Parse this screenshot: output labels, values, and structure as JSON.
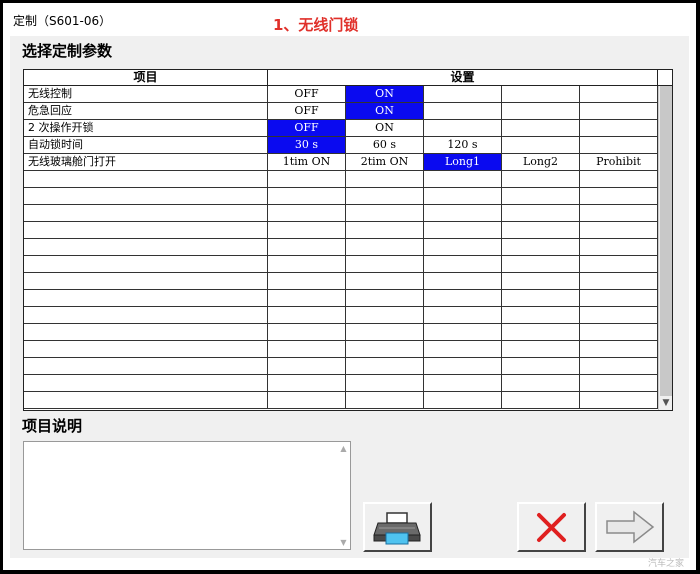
{
  "window": {
    "title": "定制（S601-06）",
    "annotation": "1、无线门锁"
  },
  "labels": {
    "select_params": "选择定制参数",
    "item_desc": "项目说明"
  },
  "table": {
    "headers": [
      "项目",
      "设置"
    ],
    "rows": [
      {
        "item": "无线控制",
        "options": [
          "OFF",
          "ON",
          "",
          "",
          ""
        ],
        "selected": 1
      },
      {
        "item": "危急回应",
        "options": [
          "OFF",
          "ON",
          "",
          "",
          ""
        ],
        "selected": 1
      },
      {
        "item": "2 次操作开锁",
        "options": [
          "OFF",
          "ON",
          "",
          "",
          ""
        ],
        "selected": 0
      },
      {
        "item": "自动锁时间",
        "options": [
          "30 s",
          "60 s",
          "120 s",
          "",
          ""
        ],
        "selected": 0
      },
      {
        "item": "无线玻璃舱门打开",
        "options": [
          "1tim ON",
          "2tim ON",
          "Long1",
          "Long2",
          "Prohibit"
        ],
        "selected": 2
      },
      {
        "item": "",
        "options": [
          "",
          "",
          "",
          "",
          ""
        ],
        "selected": -1
      },
      {
        "item": "",
        "options": [
          "",
          "",
          "",
          "",
          ""
        ],
        "selected": -1
      },
      {
        "item": "",
        "options": [
          "",
          "",
          "",
          "",
          ""
        ],
        "selected": -1
      },
      {
        "item": "",
        "options": [
          "",
          "",
          "",
          "",
          ""
        ],
        "selected": -1
      },
      {
        "item": "",
        "options": [
          "",
          "",
          "",
          "",
          ""
        ],
        "selected": -1
      },
      {
        "item": "",
        "options": [
          "",
          "",
          "",
          "",
          ""
        ],
        "selected": -1
      },
      {
        "item": "",
        "options": [
          "",
          "",
          "",
          "",
          ""
        ],
        "selected": -1
      },
      {
        "item": "",
        "options": [
          "",
          "",
          "",
          "",
          ""
        ],
        "selected": -1
      },
      {
        "item": "",
        "options": [
          "",
          "",
          "",
          "",
          ""
        ],
        "selected": -1
      },
      {
        "item": "",
        "options": [
          "",
          "",
          "",
          "",
          ""
        ],
        "selected": -1
      },
      {
        "item": "",
        "options": [
          "",
          "",
          "",
          "",
          ""
        ],
        "selected": -1
      },
      {
        "item": "",
        "options": [
          "",
          "",
          "",
          "",
          ""
        ],
        "selected": -1
      },
      {
        "item": "",
        "options": [
          "",
          "",
          "",
          "",
          ""
        ],
        "selected": -1
      },
      {
        "item": "",
        "options": [
          "",
          "",
          "",
          "",
          ""
        ],
        "selected": -1
      }
    ]
  },
  "description": {
    "text": ""
  },
  "buttons": {
    "print_icon": "printer-icon",
    "cancel_icon": "red-x-icon",
    "next_icon": "right-arrow-icon"
  },
  "colors": {
    "selected_bg": "#0a0af0",
    "annotation": "#e0302a",
    "cancel_x": "#e02020"
  },
  "watermark": "汽车之家"
}
